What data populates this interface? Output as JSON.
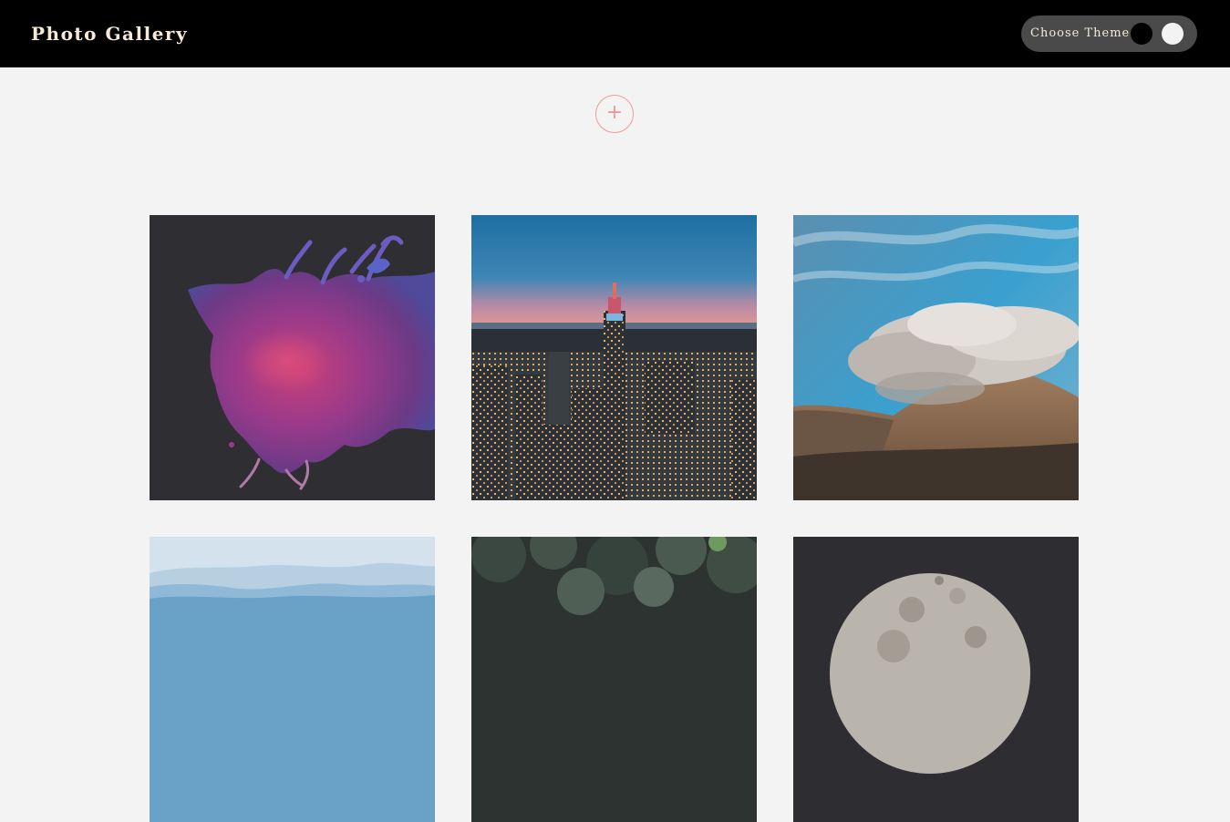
{
  "header": {
    "title": "Photo Gallery",
    "background": "#000000",
    "text_color": "#f5ead7"
  },
  "theme_picker": {
    "label": "Choose Theme",
    "options": [
      {
        "name": "dark",
        "color": "#000000"
      },
      {
        "name": "light",
        "color": "#f3f3f3"
      }
    ]
  },
  "add_button": {
    "icon": "plus-icon",
    "symbol": "+",
    "color": "#ee9a9a"
  },
  "gallery": {
    "background": "#f3f3f3",
    "photos": [
      {
        "subject": "purple-paint-splash"
      },
      {
        "subject": "city-skyline-at-dusk"
      },
      {
        "subject": "cloud-covered-mountain"
      },
      {
        "subject": "misty-blue-mountains"
      },
      {
        "subject": "forest-foliage"
      },
      {
        "subject": "moon-surface"
      }
    ]
  }
}
